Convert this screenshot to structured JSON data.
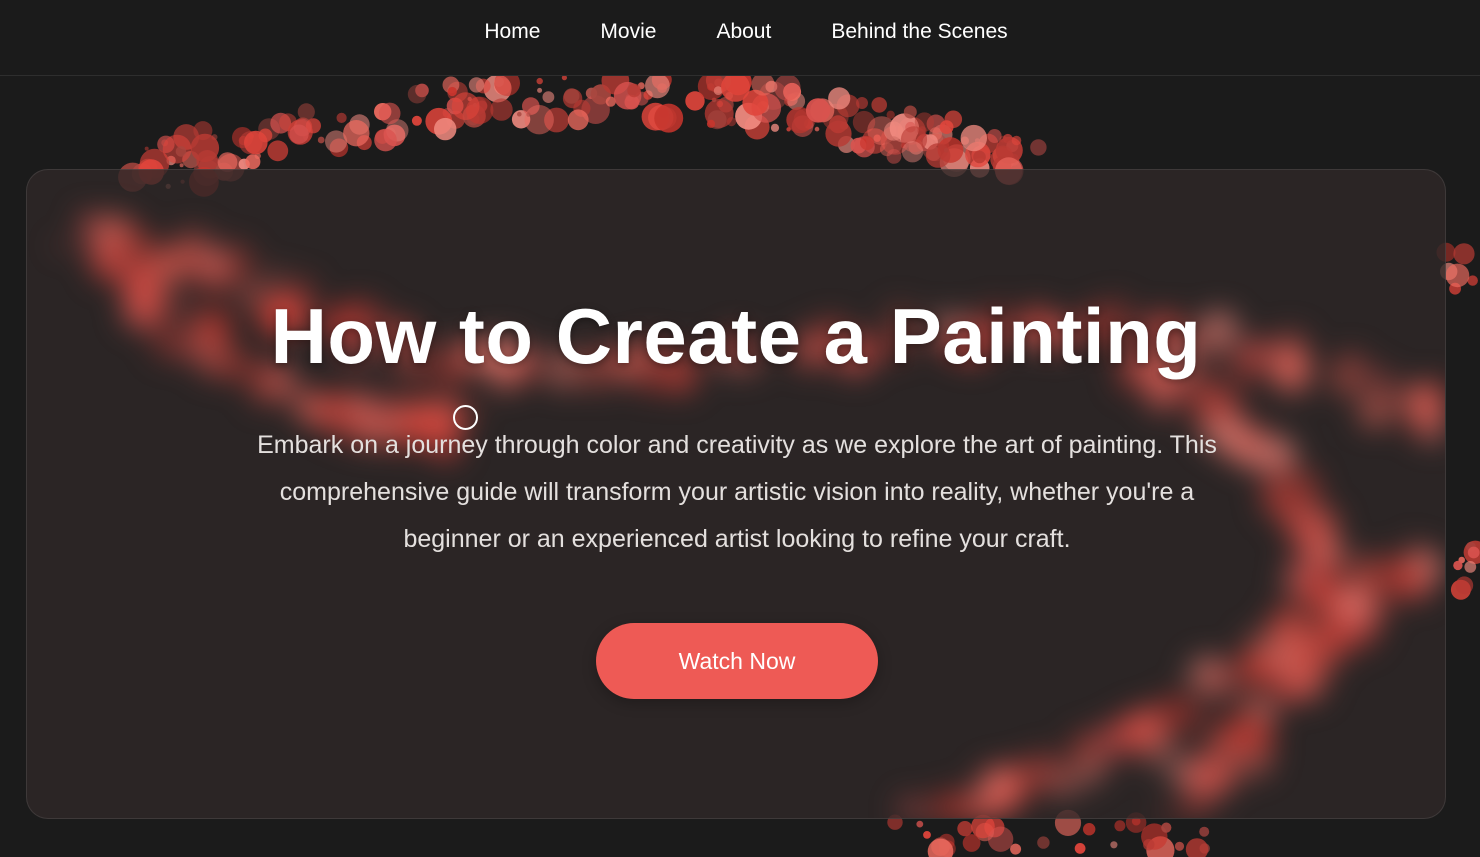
{
  "nav": {
    "items": [
      {
        "label": "Home"
      },
      {
        "label": "Movie"
      },
      {
        "label": "About"
      },
      {
        "label": "Behind the Scenes"
      }
    ]
  },
  "hero": {
    "title": "How to Create a Painting",
    "description": "Embark on a journey through color and creativity as we explore the art of painting. This comprehensive guide will transform your artistic vision into reality, whether you're a beginner or an experienced artist looking to refine your craft.",
    "cta_label": "Watch Now"
  },
  "colors": {
    "background": "#1b1b1b",
    "card": "#302828",
    "accent": "#ee5a55",
    "particle": "#e0453b",
    "text": "#ffffff"
  }
}
